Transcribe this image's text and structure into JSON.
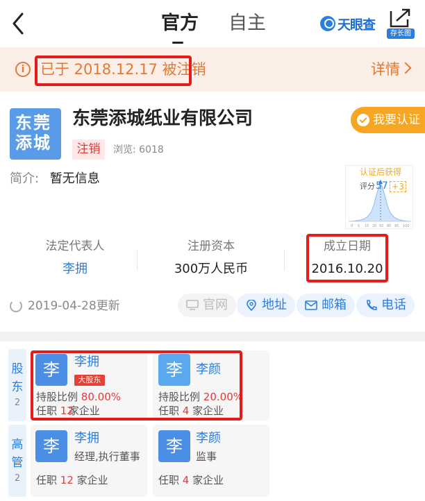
{
  "nav": {
    "tabs": [
      "官方",
      "自主"
    ],
    "brand": "天眼查",
    "long_image_label": "存长图"
  },
  "notice": {
    "text": "已于 2018.12.17 被注销",
    "detail": "详情"
  },
  "company": {
    "logo_line1": "东莞",
    "logo_line2": "添城",
    "name": "东莞添城纸业有限公司",
    "status": "注销",
    "views": "浏览: 6018",
    "verify": "我要认证",
    "intro_label": "简介:",
    "intro_value": "暂无信息"
  },
  "score": {
    "title": "认证后获得",
    "label": "评分",
    "value": "57",
    "bonus": "+3",
    "axis": [
      "0",
      "5",
      "10",
      "20",
      "50",
      "80",
      "95",
      "100"
    ]
  },
  "basic_info": {
    "legal_rep_label": "法定代表人",
    "legal_rep": "李拥",
    "capital_label": "注册资本",
    "capital": "300万人民币",
    "founded_label": "成立日期",
    "founded": "2016.10.20"
  },
  "updated": "2019-04-28更新",
  "actions": {
    "website": "官网",
    "address": "地址",
    "email": "邮箱",
    "phone": "电话"
  },
  "shareholders": {
    "label": "股东",
    "count": "2",
    "items": [
      {
        "avatar": "李",
        "name": "李拥",
        "tag": "大股东",
        "ratio_label": "持股比例",
        "ratio": "80.00%",
        "job_prefix": "任职",
        "job_count": "12",
        "job_suffix": "家企业"
      },
      {
        "avatar": "李",
        "name": "李颜",
        "ratio_label": "持股比例",
        "ratio": "20.00%",
        "job_prefix": "任职",
        "job_count": "4",
        "job_suffix": "家企业"
      }
    ]
  },
  "executives": {
    "label": "高管",
    "count": "2",
    "items": [
      {
        "avatar": "李",
        "name": "李拥",
        "role": "经理,执行董事",
        "job_prefix": "任职",
        "job_count": "12",
        "job_suffix": "家企业"
      },
      {
        "avatar": "李",
        "name": "李颜",
        "role": "监事",
        "job_prefix": "任职",
        "job_count": "4",
        "job_suffix": "家企业"
      }
    ]
  },
  "colors": {
    "accent": "#2a7ee0",
    "warning": "#e07a35",
    "danger": "#e5393b",
    "highlight_box": "#e31b1b",
    "verify": "#f6a623"
  }
}
